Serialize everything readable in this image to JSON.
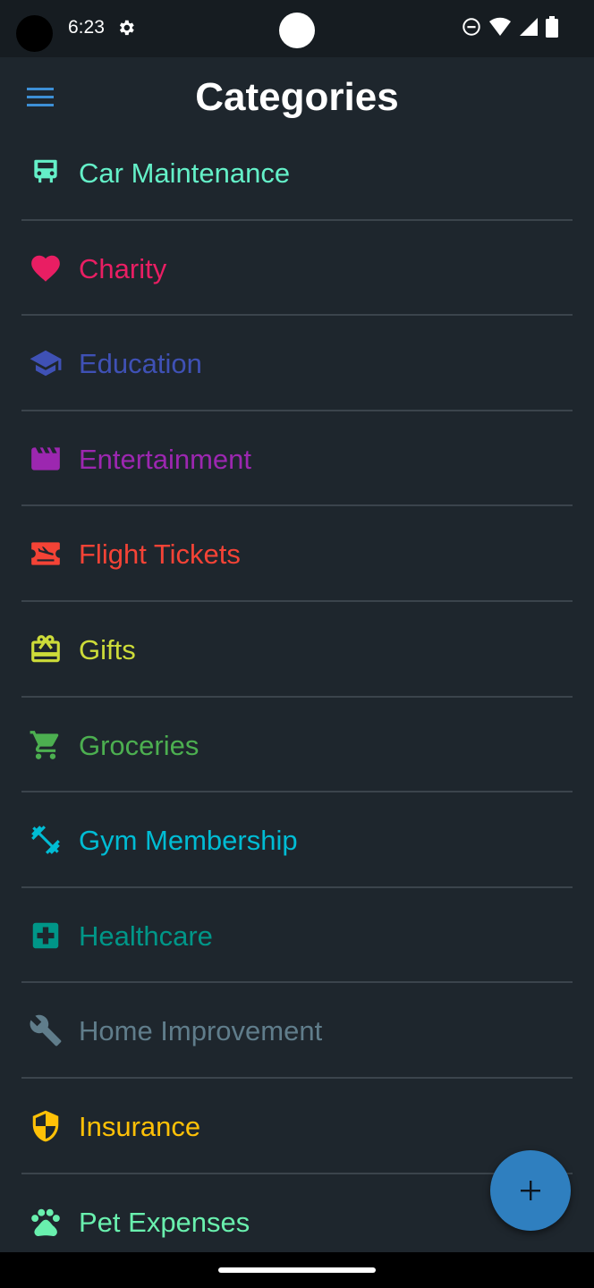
{
  "status_bar": {
    "time": "6:23"
  },
  "app_bar": {
    "title": "Categories"
  },
  "categories": [
    {
      "label": "Car Maintenance",
      "icon": "car-icon",
      "color": "#64f0c8"
    },
    {
      "label": "Charity",
      "icon": "heart-icon",
      "color": "#e91e63"
    },
    {
      "label": "Education",
      "icon": "school-icon",
      "color": "#3f51b5"
    },
    {
      "label": "Entertainment",
      "icon": "movie-icon",
      "color": "#9c27b0"
    },
    {
      "label": "Flight Tickets",
      "icon": "flight-ticket-icon",
      "color": "#f44336"
    },
    {
      "label": "Gifts",
      "icon": "gift-card-icon",
      "color": "#cddc39"
    },
    {
      "label": "Groceries",
      "icon": "cart-icon",
      "color": "#4caf50"
    },
    {
      "label": "Gym Membership",
      "icon": "dumbbell-icon",
      "color": "#00bcd4"
    },
    {
      "label": "Healthcare",
      "icon": "medical-icon",
      "color": "#009688"
    },
    {
      "label": "Home Improvement",
      "icon": "wrench-icon",
      "color": "#607d8b"
    },
    {
      "label": "Insurance",
      "icon": "shield-icon",
      "color": "#ffc107"
    },
    {
      "label": "Pet Expenses",
      "icon": "paw-icon",
      "color": "#69f0ae"
    }
  ],
  "fab": {
    "icon": "plus-icon",
    "color": "#2f7fbf"
  }
}
